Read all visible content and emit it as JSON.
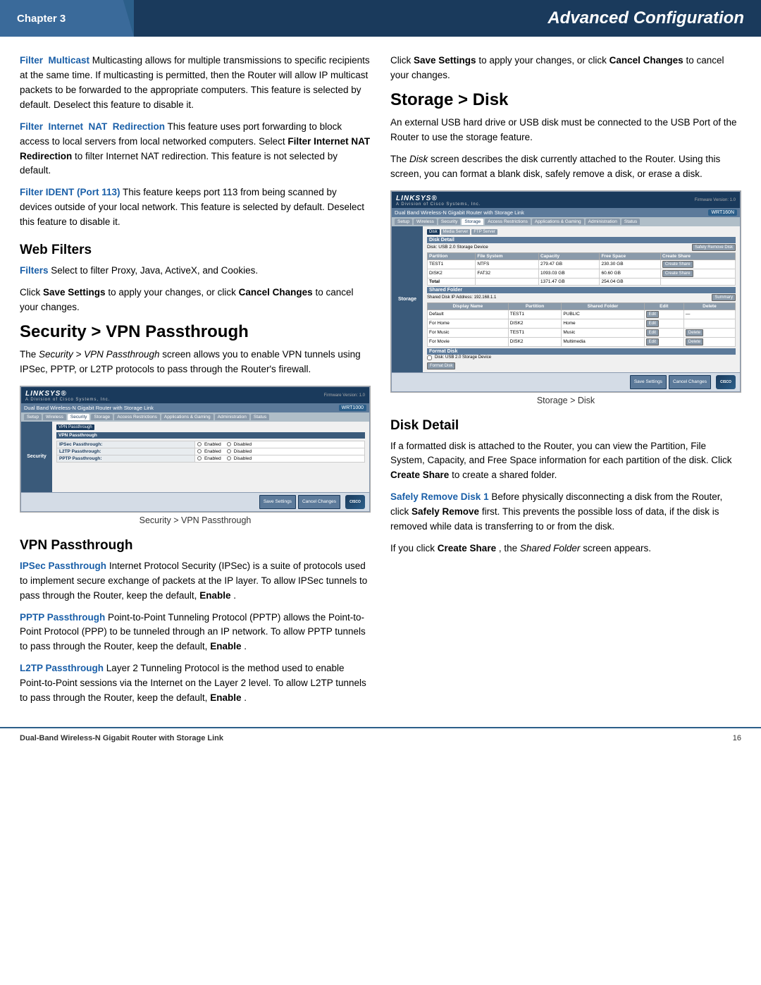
{
  "header": {
    "chapter": "Chapter 3",
    "title": "Advanced Configuration"
  },
  "footer": {
    "product": "Dual-Band Wireless-N Gigabit Router with Storage Link",
    "page": "16"
  },
  "left_col": {
    "paragraphs": [
      {
        "id": "filter-multicast",
        "label": "Filter  Multicast",
        "text": " Multicasting  allows  for  multiple transmissions to specific recipients at the same time. If multicasting is permitted, then the Router will allow IP multicast packets to be forwarded to the appropriate computers. This feature is selected by default. Deselect this feature to disable it."
      },
      {
        "id": "filter-nat",
        "label": "Filter  Internet  NAT  Redirection",
        "text": " This  feature  uses port  forwarding to block access to local servers from local networked computers. Select ",
        "label2": "Filter  Internet  NAT Redirection",
        "text2": " to filter Internet NAT redirection. This feature is not selected by default."
      },
      {
        "id": "filter-ident",
        "label": "Filter IDENT (Port 113)",
        "text": "  This feature keeps port 113 from being scanned by devices outside of your local network. This feature is selected by default. Deselect this feature to disable it."
      }
    ],
    "web_filters_heading": "Web Filters",
    "filters_text": "Filters",
    "filters_desc": "  Select to filter Proxy, Java, ActiveX, and Cookies.",
    "save_settings_text": "Click ",
    "save_settings_bold": "Save Settings",
    "save_settings_text2": " to apply your changes, or click ",
    "cancel_bold": "Cancel Changes",
    "cancel_text": " to cancel your changes.",
    "vpn_heading": "Security > VPN Passthrough",
    "vpn_desc": "The ",
    "vpn_italic": "Security > VPN Passthrough",
    "vpn_desc2": " screen allows you to enable VPN  tunnels  using  IPSec,  PPTP,  or  L2TP  protocols  to  pass through the Router's firewall.",
    "vpn_screenshot_caption": "Security > VPN Passthrough",
    "vpn_passthrough_heading": "VPN Passthrough",
    "ipsec": {
      "label": "IPSec Passthrough",
      "text": "  Internet Protocol Security (IPSec) is a suite of protocols used to implement secure exchange of packets at the IP layer. To allow IPSec tunnels to pass through the Router, keep the default, ",
      "bold": "Enable",
      "text2": "."
    },
    "pptp": {
      "label": "PPTP Passthrough",
      "text": "  Point-to-Point  Tunneling  Protocol (PPTP) allows the Point-to-Point Protocol (PPP) to be tunneled through an IP network. To allow PPTP tunnels to pass through the Router, keep the default, ",
      "bold": "Enable",
      "text2": "."
    },
    "l2tp": {
      "label": "L2TP Passthrough",
      "text": "  Layer  2  Tunneling  Protocol  is  the method  used  to  enable  Point-to-Point  sessions  via  the Internet on the Layer 2 level. To allow L2TP tunnels to pass through the Router, keep the default, ",
      "bold": "Enable",
      "text2": "."
    }
  },
  "right_col": {
    "save_click": "Click ",
    "save_bold": "Save Settings",
    "save_text": " to apply your changes, or click ",
    "cancel_bold": "Cancel Changes",
    "cancel_text": " to cancel your changes.",
    "storage_disk_heading": "Storage > Disk",
    "storage_desc": "An external USB hard drive or USB disk must be connected to the USB Port of the Router to use the storage feature.",
    "storage_desc2_start": "The ",
    "storage_italic": "Disk",
    "storage_desc2_end": " screen describes the disk currently attached to the Router. Using this screen, you can format a blank disk, safely remove a disk, or erase a disk.",
    "screenshot_caption": "Storage > Disk",
    "disk_detail_heading": "Disk Detail",
    "disk_detail_desc": "If  a  formatted  disk  is  attached  to  the  Router,  you  can view the Partition, File System, Capacity, and Free Space information  for  each  partition  of  the  disk.  Click  ",
    "create_share_bold": "Create Share",
    "disk_detail_desc2": " to create a shared folder.",
    "safely_remove": {
      "label": "Safely Remove Disk 1",
      "text": "  Before  physically  disconnecting a  disk  from  the  Router,  click  ",
      "bold": "Safely Remove",
      "text2": "  first.  This prevents the possible loss of data, if the disk is removed while data is transferring to or from the disk."
    },
    "create_share_note_start": "If you click ",
    "create_share_note_bold": "Create Share",
    "create_share_note_italic": "Shared Folder",
    "create_share_note_end": " screen appears.",
    "linksys_ui": {
      "logo": "LINKSYS®",
      "logo_sub": "A Division of Cisco Systems, Inc.",
      "title": "Dual Band Wireless-N Gigabit Router with Storage Link",
      "model": "WRT160N",
      "nav_items": [
        "Setup",
        "Wireless",
        "Security",
        "Storage",
        "Access Restrictions",
        "Applications & Gaming",
        "Administration",
        "Status"
      ],
      "active_nav": "Storage",
      "subnav_items": [
        "Disk",
        "Media Server",
        "FTP Server"
      ],
      "active_subnav": "Disk",
      "safely_remove_btn": "Safely Remove Disk",
      "disk_usb_label": "Disk: USB 2.0 Storage Device",
      "table_headers": [
        "Partition",
        "File System",
        "Capacity",
        "Free Space",
        "Create Share"
      ],
      "table_rows": [
        [
          "TEST1",
          "NTFS",
          "279.47 GB",
          "230.30 GB",
          "Create Share"
        ],
        [
          "DISK2",
          "FAT32",
          "1093.03 GB",
          "60.60 GB",
          "Create Share"
        ],
        [
          "Total",
          "",
          "1371.47 GB",
          "254.04 GB",
          ""
        ]
      ],
      "shared_folder_label": "Shared Folder",
      "shared_ip": "Shared Disk IP Address: 192.168.1.1",
      "summary_btn": "Summary",
      "shared_headers": [
        "Display Name",
        "Partition",
        "Shared Folder",
        "Edit",
        "Delete"
      ],
      "shared_rows": [
        [
          "Default",
          "TEST1",
          "PUBLIC",
          "Edit",
          "—"
        ],
        [
          "For Home",
          "DISK2",
          "Home",
          "Edit",
          ""
        ],
        [
          "For Music",
          "TEST1",
          "Music",
          "Edit",
          "Delete"
        ],
        [
          "For Movie",
          "DISK2",
          "Multimedia",
          "Edit",
          "Delete"
        ]
      ],
      "format_disk_label": "Format Disk",
      "format_checkbox": "Disk: USB 2.0 Storage Device",
      "format_btn": "Format Disk",
      "save_btn": "Save Settings",
      "cancel_btn": "Cancel Changes"
    },
    "vpn_ui": {
      "logo": "LINKSYS®",
      "logo_sub": "A Division of Cisco Systems, Inc.",
      "title": "Dual Band Wireless-N Gigabit Router with Storage Link",
      "model": "WRT1000",
      "nav_items": [
        "Setup",
        "Wireless",
        "Security",
        "Storage",
        "Access Restrictions",
        "Applications & Gaming",
        "Administration",
        "Status"
      ],
      "active_nav": "Security",
      "subnav": "VPN Passthrough",
      "rows": [
        {
          "label": "IPSec Passthrough:",
          "value": "Enabled / Disabled"
        },
        {
          "label": "L2TP Passthrough:",
          "value": "Enabled / Disabled"
        },
        {
          "label": "PPTP Passthrough:",
          "value": "Enabled / Disabled"
        }
      ],
      "save_btn": "Save Settings",
      "cancel_btn": "Cancel Changes"
    }
  }
}
